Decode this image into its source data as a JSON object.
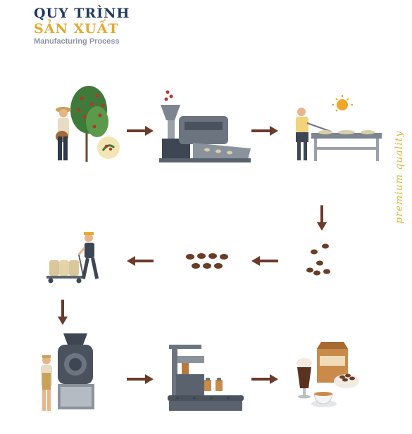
{
  "title": {
    "line1": "QUY TRÌNH",
    "line2": "SẢN XUẤT",
    "line3": "Manufacturing Process"
  },
  "side_text": "premium quality",
  "steps": [
    {
      "icon": "coffee-harvest-icon"
    },
    {
      "icon": "washing-machine-icon"
    },
    {
      "icon": "sun-drying-icon"
    },
    {
      "icon": "green-beans-icon"
    },
    {
      "icon": "sorted-beans-icon"
    },
    {
      "icon": "bagging-cart-icon"
    },
    {
      "icon": "roaster-icon"
    },
    {
      "icon": "packaging-line-icon"
    },
    {
      "icon": "coffee-products-icon"
    }
  ],
  "colors": {
    "navy": "#1f3a5c",
    "gold": "#e3a92f",
    "arrow": "#6b3a2a",
    "bean": "#6a3d26"
  }
}
